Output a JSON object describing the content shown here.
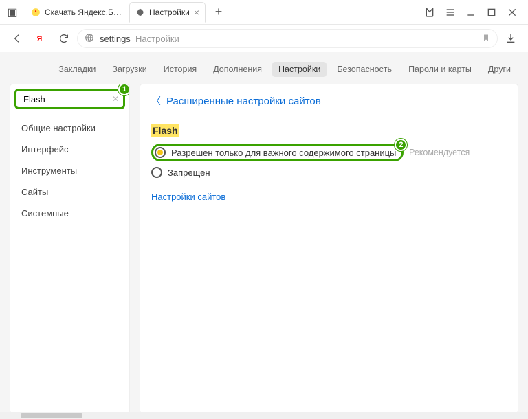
{
  "titlebar": {
    "tabs": [
      {
        "title": "Скачать Яндекс.Браузер д",
        "favicon": "yandex"
      },
      {
        "title": "Настройки",
        "favicon": "gear",
        "active": true
      }
    ]
  },
  "addressbar": {
    "url_prefix": "settings",
    "url_suffix": "Настройки"
  },
  "settings_nav": {
    "items": [
      "Закладки",
      "Загрузки",
      "История",
      "Дополнения",
      "Настройки",
      "Безопасность",
      "Пароли и карты",
      "Други"
    ],
    "active_index": 4
  },
  "sidebar": {
    "search_value": "Flash",
    "items": [
      "Общие настройки",
      "Интерфейс",
      "Инструменты",
      "Сайты",
      "Системные"
    ]
  },
  "main": {
    "back_link": "Расширенные настройки сайтов",
    "section_title": "Flash",
    "radios": [
      {
        "label": "Разрешен только для важного содержимого страницы",
        "checked": true,
        "recommended": "Рекомендуется",
        "highlighted": true
      },
      {
        "label": "Запрещен",
        "checked": false
      }
    ],
    "site_settings_link": "Настройки сайтов"
  },
  "callouts": {
    "one": "1",
    "two": "2"
  }
}
